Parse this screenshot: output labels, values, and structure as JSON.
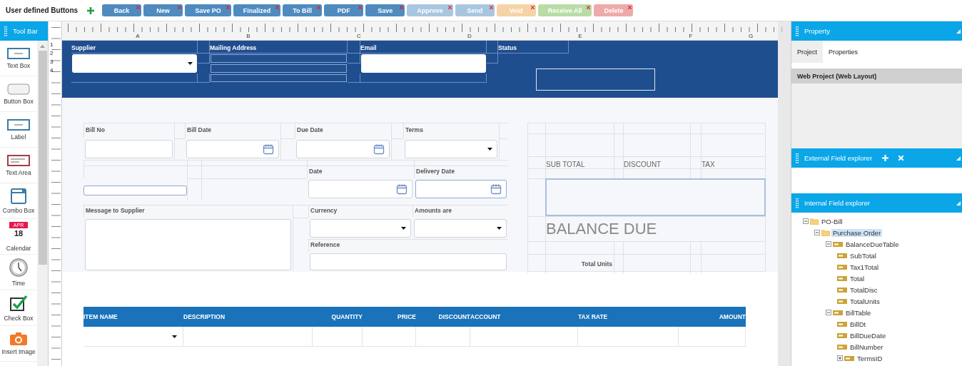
{
  "top_bar": {
    "title": "User defined Buttons",
    "buttons": [
      {
        "label": "Back",
        "color": "#4f8bbf"
      },
      {
        "label": "New",
        "color": "#4f8bbf"
      },
      {
        "label": "Save PO",
        "color": "#4f8bbf"
      },
      {
        "label": "Finalized",
        "color": "#4f8bbf"
      },
      {
        "label": "To Bill",
        "color": "#4f8bbf"
      },
      {
        "label": "PDF",
        "color": "#4f8bbf"
      },
      {
        "label": "Save",
        "color": "#4f8bbf"
      },
      {
        "label": "Approve",
        "color": "#a9c6df"
      },
      {
        "label": "Send",
        "color": "#a9c6df"
      },
      {
        "label": "Void",
        "color": "#f5d3a6"
      },
      {
        "label": "Receive All",
        "color": "#b9dca6"
      },
      {
        "label": "Delete",
        "color": "#eeaaaa"
      }
    ]
  },
  "toolbar": {
    "title": "Tool Bar",
    "items": [
      {
        "kind": "textbox",
        "label": "Text Box"
      },
      {
        "kind": "button",
        "label": "Button Box"
      },
      {
        "kind": "label",
        "label": "Label"
      },
      {
        "kind": "textarea",
        "label": "Text Area"
      },
      {
        "kind": "combo",
        "label": "Combo Box"
      },
      {
        "kind": "calendar",
        "label": "Calendar",
        "icon_month": "APR",
        "icon_day": "18"
      },
      {
        "kind": "time",
        "label": "Time"
      },
      {
        "kind": "checkbox",
        "label": "Check Box"
      },
      {
        "kind": "image",
        "label": "Insert Image"
      }
    ]
  },
  "ruler": {
    "columns": [
      "A",
      "B",
      "C",
      "D",
      "E",
      "F",
      "G"
    ],
    "rows": [
      "1",
      "2",
      "3",
      "4"
    ]
  },
  "header_band": {
    "supplier": "Supplier",
    "mailing_address": "Mailing Address",
    "email": "Email",
    "status": "Status"
  },
  "bill_form": {
    "row1": [
      {
        "label": "Bill No",
        "kind": "text"
      },
      {
        "label": "Bill Date",
        "kind": "date"
      },
      {
        "label": "Due Date",
        "kind": "date"
      },
      {
        "label": "Terms",
        "kind": "dropdown"
      }
    ],
    "row2": [
      {
        "label": "Date",
        "kind": "date"
      },
      {
        "label": "Delivery Date",
        "kind": "date"
      }
    ],
    "message": "Message to Supplier",
    "row3": [
      {
        "label": "Currency",
        "kind": "dropdown"
      },
      {
        "label": "Amounts are",
        "kind": "dropdown"
      }
    ],
    "reference": "Reference"
  },
  "totals": {
    "columns": [
      "SUB TOTAL",
      "DISCOUNT",
      "TAX"
    ],
    "balance_due": "BALANCE DUE",
    "total_units": "Total Units"
  },
  "items_table": {
    "columns": [
      "ITEM NAME",
      "DESCRIPTION",
      "QUANTITY",
      "PRICE",
      "DISCOUNT",
      "ACCOUNT",
      "TAX RATE",
      "AMOUNT"
    ]
  },
  "property_panel": {
    "title": "Property",
    "tabs": [
      {
        "label": "Project",
        "selected": true
      },
      {
        "label": "Properties",
        "selected": false
      }
    ],
    "section": "Web Project (Web Layout)"
  },
  "external_panel": {
    "title": "External Field explorer"
  },
  "internal_panel": {
    "title": "Internal Field explorer",
    "tree": [
      {
        "label": "PO-Bill",
        "kind": "folder",
        "expanded": true,
        "selected": false,
        "children": [
          {
            "label": "Purchase Order",
            "kind": "folder",
            "expanded": true,
            "selected": true,
            "children": [
              {
                "label": "BalanceDueTable",
                "kind": "field",
                "expanded": true,
                "selected": false,
                "children": [
                  {
                    "label": "SubTotal",
                    "kind": "field",
                    "selected": false
                  },
                  {
                    "label": "Tax1Total",
                    "kind": "field",
                    "selected": false
                  },
                  {
                    "label": "Total",
                    "kind": "field",
                    "selected": false
                  },
                  {
                    "label": "TotalDisc",
                    "kind": "field",
                    "selected": false
                  },
                  {
                    "label": "TotalUnits",
                    "kind": "field",
                    "selected": false
                  }
                ]
              },
              {
                "label": "BillTable",
                "kind": "field",
                "expanded": true,
                "selected": false,
                "children": [
                  {
                    "label": "BillDt",
                    "kind": "field",
                    "selected": false
                  },
                  {
                    "label": "BillDueDate",
                    "kind": "field",
                    "selected": false
                  },
                  {
                    "label": "BillNumber",
                    "kind": "field",
                    "selected": false
                  },
                  {
                    "label": "TermsID",
                    "kind": "field",
                    "expanded": false,
                    "selected": false
                  }
                ]
              }
            ]
          }
        ]
      }
    ]
  }
}
